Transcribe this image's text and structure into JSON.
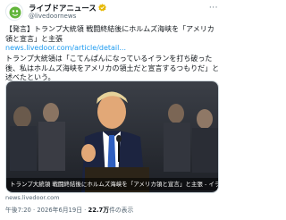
{
  "account": {
    "name": "ライブドアニュース",
    "handle": "@livedoornews",
    "avatar_icon": "livedoor-logo-icon",
    "verified_icon": "verified-badge-icon",
    "more_icon": "more-options-icon"
  },
  "tweet": {
    "headline": "【発言】トランプ大統領 戦闘終結後にホルムズ海峡を「アメリカ領と宣言」と主張",
    "link": "news.livedoor.com/article/detail...",
    "quote": "トランプ大統領は「こてんぱんになっているイランを打ち破った後、私はホルムズ海峡をアメリカの領土だと宣言するつもりだ」と述べたという。"
  },
  "card": {
    "caption": "トランプ大統領 戦闘終結後にホルムズ海峡を「アメリカ領と宣言」と主張 - イランへ...",
    "domain": "news.livedoor.com",
    "photo_icon": "speaker-at-podium-photo"
  },
  "meta": {
    "time": "午後7:20",
    "date": "2026年6月19日",
    "views_count": "22.7万",
    "views_label": "件の表示"
  },
  "colors": {
    "link": "#1d9bf0",
    "secondary_text": "#536471",
    "verified": "#e6b800",
    "brand_green": "#62b53b"
  }
}
